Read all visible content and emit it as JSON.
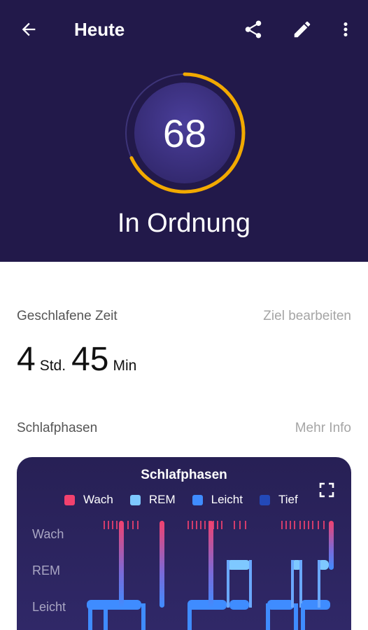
{
  "header": {
    "title": "Heute",
    "score": "68",
    "rating": "In Ordnung",
    "score_fraction": 0.68,
    "icons": [
      "arrow-back-icon",
      "share-icon",
      "pencil-icon",
      "more-vert-icon"
    ]
  },
  "sleep_time": {
    "label": "Geschlafene Zeit",
    "link": "Ziel bearbeiten",
    "hours": "4",
    "hours_unit": "Std.",
    "minutes": "45",
    "minutes_unit": "Min"
  },
  "phases": {
    "label": "Schlafphasen",
    "link": "Mehr Info"
  },
  "card": {
    "title": "Schlafphasen",
    "legend": [
      {
        "label": "Wach",
        "color": "#f2416e"
      },
      {
        "label": "REM",
        "color": "#7ec8ff"
      },
      {
        "label": "Leicht",
        "color": "#3f8cff"
      },
      {
        "label": "Tief",
        "color": "#2349b8"
      }
    ],
    "y_labels": [
      "Wach",
      "REM",
      "Leicht"
    ]
  },
  "colors": {
    "header_bg": "#22194a",
    "ring": "#f2a900",
    "card_bg": "#2b235e"
  }
}
